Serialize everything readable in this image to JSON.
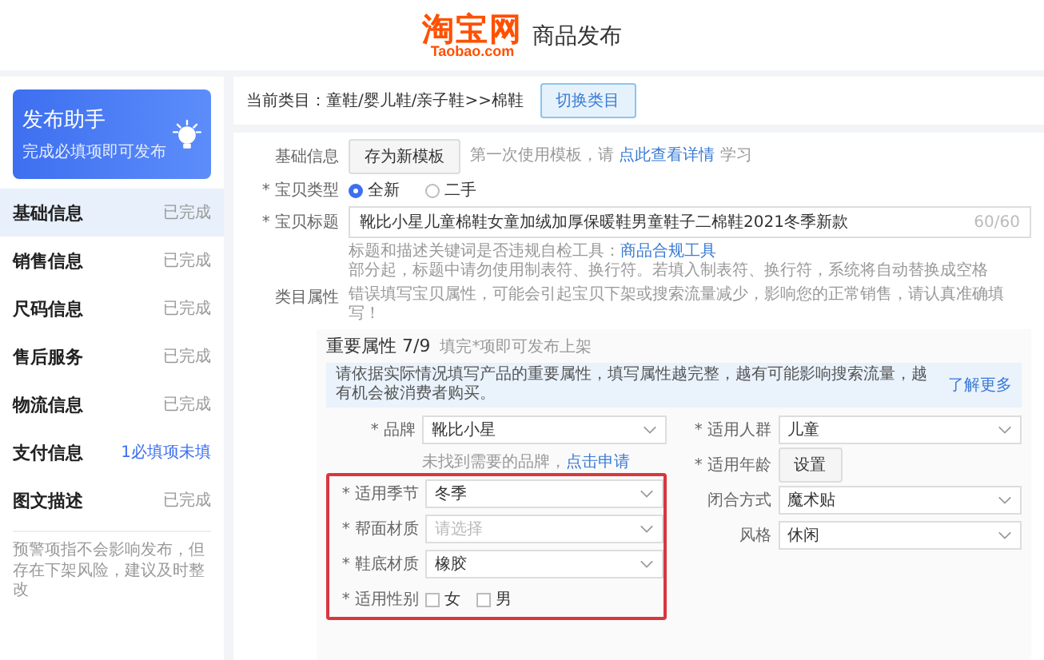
{
  "header": {
    "logo_name": "淘宝网",
    "logo_domain": "Taobao.com",
    "title": "商品发布"
  },
  "sidebar": {
    "assistant": {
      "title": "发布助手",
      "subtitle": "完成必填项即可发布"
    },
    "items": [
      {
        "label": "基础信息",
        "status": "已完成",
        "selected": true,
        "pending": false
      },
      {
        "label": "销售信息",
        "status": "已完成",
        "selected": false,
        "pending": false
      },
      {
        "label": "尺码信息",
        "status": "已完成",
        "selected": false,
        "pending": false
      },
      {
        "label": "售后服务",
        "status": "已完成",
        "selected": false,
        "pending": false
      },
      {
        "label": "物流信息",
        "status": "已完成",
        "selected": false,
        "pending": false
      },
      {
        "label": "支付信息",
        "status": "1必填项未填",
        "selected": false,
        "pending": true
      },
      {
        "label": "图文描述",
        "status": "已完成",
        "selected": false,
        "pending": false
      }
    ],
    "note": "预警项指不会影响发布，但存在下架风险，建议及时整改"
  },
  "category_bar": {
    "text": "当前类目：童鞋/婴儿鞋/亲子鞋>>棉鞋",
    "button": "切换类目"
  },
  "basic": {
    "label": "基础信息",
    "template_button": "存为新模板",
    "template_hint": "第一次使用模板，请",
    "template_link": "点此查看详情",
    "template_tail": "学习"
  },
  "item_type": {
    "label": "* 宝贝类型",
    "options": [
      {
        "label": "全新",
        "selected": true
      },
      {
        "label": "二手",
        "selected": false
      }
    ]
  },
  "item_title": {
    "label": "* 宝贝标题",
    "value": "靴比小星儿童棉鞋女童加绒加厚保暖鞋男童鞋子二棉鞋2021冬季新款",
    "counter": "60/60",
    "hint_1": "标题和描述关键词是否违规自检工具：",
    "hint_link": "商品合规工具",
    "hint_2": "部分起，标题中请勿使用制表符、换行符。若填入制表符、换行符，系统将自动替换成空格"
  },
  "category_attrs": {
    "label": "类目属性",
    "warning": "错误填写宝贝属性，可能会引起宝贝下架或搜索流量减少，影响您的正常销售，请认真准确填写！"
  },
  "key_attrs": {
    "title": "重要属性",
    "count": "7/9",
    "hint": "填完*项即可发布上架",
    "info": "请依据实际情况填写产品的重要属性，填写属性越完整，越有可能影响搜索流量，越有机会被消费者购买。",
    "more_link": "了解更多",
    "brand": {
      "label": "* 品牌",
      "value": "靴比小星",
      "hint": "未找到需要的品牌，",
      "hint_link": "点击申请"
    },
    "highlighted_fields": [
      {
        "kind": "select",
        "label": "* 适用季节",
        "value": "冬季"
      },
      {
        "kind": "select",
        "label": "* 帮面材质",
        "placeholder": "请选择"
      },
      {
        "kind": "select",
        "label": "* 鞋底材质",
        "value": "橡胶"
      },
      {
        "kind": "checkboxes",
        "label": "* 适用性别",
        "options": [
          {
            "label": "女",
            "checked": false
          },
          {
            "label": "男",
            "checked": false
          }
        ]
      }
    ],
    "right_fields": [
      {
        "kind": "select",
        "label": "* 适用人群",
        "value": "儿童"
      },
      {
        "kind": "button",
        "label": "* 适用年龄",
        "button": "设置"
      },
      {
        "kind": "select",
        "label": "闭合方式",
        "value": "魔术贴"
      },
      {
        "kind": "select",
        "label": "风格",
        "value": "休闲"
      }
    ]
  }
}
